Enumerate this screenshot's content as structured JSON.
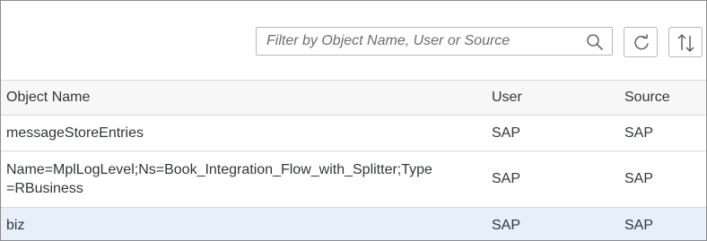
{
  "search": {
    "placeholder": "Filter by Object Name, User or Source"
  },
  "toolbar": {
    "refresh_icon": "refresh-icon",
    "sort_icon": "sort-icon"
  },
  "table": {
    "columns": [
      "Object Name",
      "User",
      "Source"
    ],
    "rows": [
      {
        "name": "messageStoreEntries",
        "user": "SAP",
        "source": "SAP"
      },
      {
        "name_line1": "Name=MplLogLevel;Ns=Book_Integration_Flow_with_Splitter;Type",
        "name_line2": "=RBusiness",
        "user": "SAP",
        "source": "SAP"
      },
      {
        "name": "biz",
        "user": "SAP",
        "source": "SAP"
      }
    ]
  },
  "colors": {
    "selected_row": "#e5f0fa",
    "header_bg": "#f7f7f7",
    "border": "#d9d9d9"
  }
}
